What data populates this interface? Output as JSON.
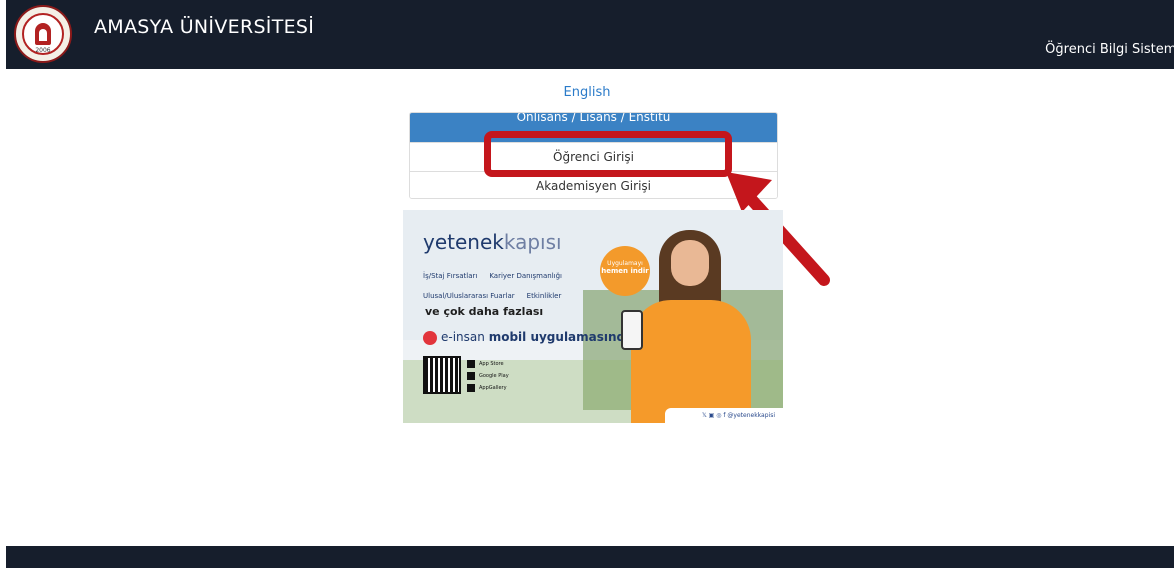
{
  "navbar": {
    "brand": "AMASYA ÜNİVERSİTESİ",
    "logo_year": "2006",
    "right_text": "Öğrenci Bilgi Sistemi"
  },
  "language_link": "English",
  "login_panel": {
    "header": "Önlisans / Lisans / Enstitü",
    "items": [
      {
        "label": "Öğrenci Girişi"
      },
      {
        "label": "Akademisyen Girişi"
      }
    ]
  },
  "banner": {
    "logo_bold": "yetenek",
    "logo_light": "kapısı",
    "bullets_row1": [
      "İş/Staj Fırsatları",
      "Kariyer Danışmanlığı"
    ],
    "bullets_row2": [
      "Ulusal/Uluslararası Fuarlar",
      "Etkinlikler"
    ],
    "more": "ve çok daha fazlası",
    "insan_brand": "e-insan",
    "insan_text": "mobil uygulamasında",
    "badge_top": "Uygulamayı",
    "badge_bottom": "hemen indir",
    "stores": [
      "App Store",
      "Google Play",
      "AppGallery"
    ],
    "social_handle": "@yetenekkapisi"
  },
  "colors": {
    "navbar_bg": "#161e2c",
    "panel_header_bg": "#3b82c4",
    "link": "#2b7bc9",
    "highlight": "#c4161c"
  }
}
